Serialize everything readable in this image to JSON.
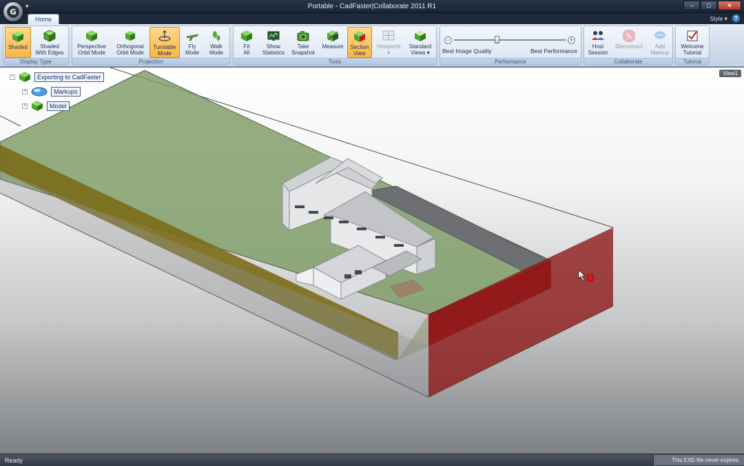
{
  "titlebar": {
    "title": "Portable - CadFaster|Collaborate 2011 R1",
    "qat": "▾",
    "orb_letter": "G"
  },
  "window_controls": {
    "minimize": "–",
    "maximize": "□",
    "close": "✕"
  },
  "tabs": {
    "home": "Home",
    "style": "Style",
    "style_chevron": "▾",
    "help": "?"
  },
  "ribbon": {
    "display_type": {
      "label": "Display Type",
      "buttons": [
        {
          "label": "Shaded",
          "active": true
        },
        {
          "label": "Shaded\nWith Edges",
          "active": false
        }
      ]
    },
    "projection": {
      "label": "Projection",
      "buttons": [
        {
          "label": "Perspective\nOrbit Mode"
        },
        {
          "label": "Orthogonal\nOrbit Mode"
        },
        {
          "label": "Turntable\nMode",
          "active": true
        },
        {
          "label": "Fly\nMode"
        },
        {
          "label": "Walk\nMode"
        }
      ]
    },
    "tools": {
      "label": "Tools",
      "buttons": [
        {
          "label": "Fit\nAll"
        },
        {
          "label": "Show\nStatistics"
        },
        {
          "label": "Take\nSnapshot"
        },
        {
          "label": "Measure"
        },
        {
          "label": "Section\nView",
          "active": true
        },
        {
          "label": "Viewports\n▾",
          "disabled": true
        },
        {
          "label": "Standard\nViews ▾"
        }
      ]
    },
    "performance": {
      "label": "Performance",
      "left_label": "Best Image Quality",
      "right_label": "Best Performance",
      "minus": "−",
      "plus": "+",
      "slider_value": 0.38
    },
    "collaborate": {
      "label": "Collaborate",
      "buttons": [
        {
          "label": "Host\nSession"
        },
        {
          "label": "Disconnect",
          "disabled": true
        },
        {
          "label": "Add\nMarkup",
          "disabled": true
        }
      ]
    },
    "tutorial": {
      "label": "Tutorial",
      "buttons": [
        {
          "label": "Welcome\nTutorial"
        }
      ]
    }
  },
  "viewport": {
    "view_name": "View1"
  },
  "tree": {
    "root": "Exporting to CadFaster",
    "children": [
      "Markups",
      "Model"
    ],
    "collapse": "−",
    "expand": "+"
  },
  "status": {
    "left": "Ready",
    "right": "This EXE-file never expires."
  },
  "colors": {
    "accent": "#f9b548",
    "section_plane": "#8c1515",
    "ground": "#7d9c67"
  }
}
